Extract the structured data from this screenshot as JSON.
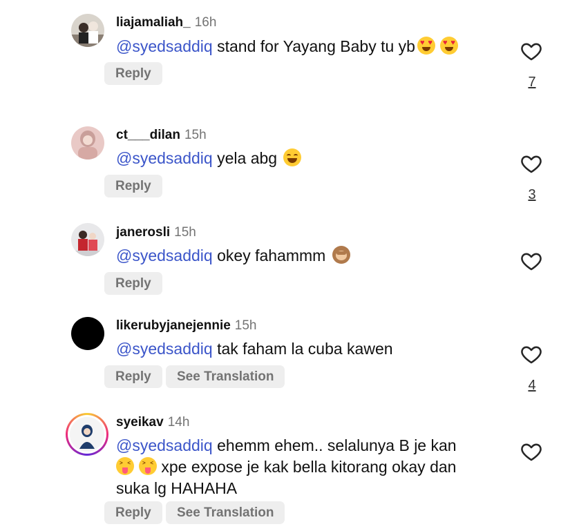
{
  "comments": [
    {
      "username": "liajamaliah_",
      "time": "16h",
      "mention": "@syedsaddiq",
      "text": "stand for Yayang Baby tu yb",
      "emojis": [
        "heart-eyes-emoji",
        "heart-eyes-emoji"
      ],
      "reply_label": "Reply",
      "likes": "7"
    },
    {
      "username": "ct___dilan",
      "time": "15h",
      "mention": "@syedsaddiq",
      "text": "yela abg",
      "emojis": [
        "tears-of-joy-emoji"
      ],
      "reply_label": "Reply",
      "likes": "3"
    },
    {
      "username": "janerosli",
      "time": "15h",
      "mention": "@syedsaddiq",
      "text": "okey fahammm",
      "emojis": [
        "see-no-evil-monkey-emoji"
      ],
      "reply_label": "Reply",
      "likes": ""
    },
    {
      "username": "likerubyjanejennie",
      "time": "15h",
      "mention": "@syedsaddiq",
      "text": "tak faham la cuba kawen",
      "emojis": [],
      "reply_label": "Reply",
      "translate_label": "See Translation",
      "likes": "4"
    },
    {
      "username": "syeikav",
      "time": "14h",
      "mention": "@syedsaddiq",
      "text_line1": "ehemm ehem.. selalunya B je kan",
      "text_line2": "xpe expose je kak bella kitorang okay dan",
      "text_line3": "suka lg HAHAHA",
      "emojis": [
        "squinting-tongue-emoji",
        "squinting-tongue-emoji"
      ],
      "reply_label": "Reply",
      "translate_label": "See Translation",
      "likes": ""
    }
  ],
  "icons": {
    "like": "heart-outline-icon"
  },
  "colors": {
    "mention": "#3b55c9",
    "muted": "#737373",
    "pill_bg": "#eeeeee"
  }
}
